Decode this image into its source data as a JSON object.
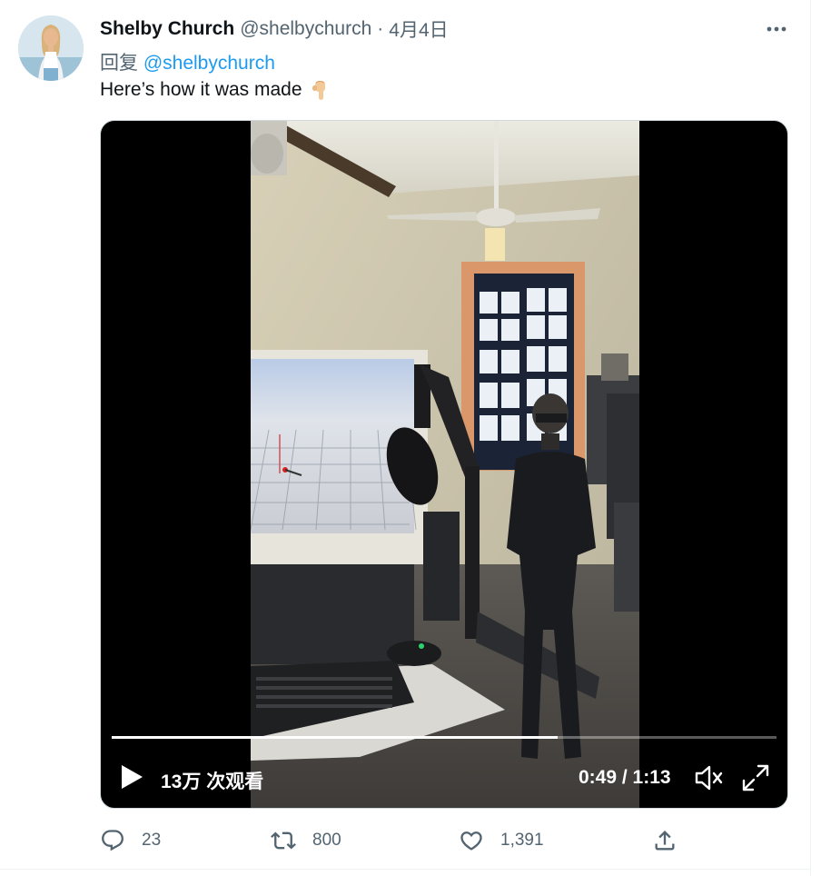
{
  "author": {
    "name": "Shelby Church",
    "handle": "@shelbychurch",
    "separator": "·",
    "date": "4月4日"
  },
  "reply": {
    "prefix": "回复",
    "mention": "@shelbychurch"
  },
  "tweet": {
    "text": "Here’s how it was made",
    "emoji_icon": "backhand-index-pointing-down-icon"
  },
  "video": {
    "views": "13万 次观看",
    "current_time": "0:49",
    "time_separator": " / ",
    "duration": "1:13",
    "progress_fraction": 0.671
  },
  "actions": {
    "reply_count": "23",
    "retweet_count": "800",
    "like_count": "1,391"
  },
  "colors": {
    "link": "#1d9bf0",
    "secondary_text": "#536471",
    "primary_text": "#0f1419"
  }
}
